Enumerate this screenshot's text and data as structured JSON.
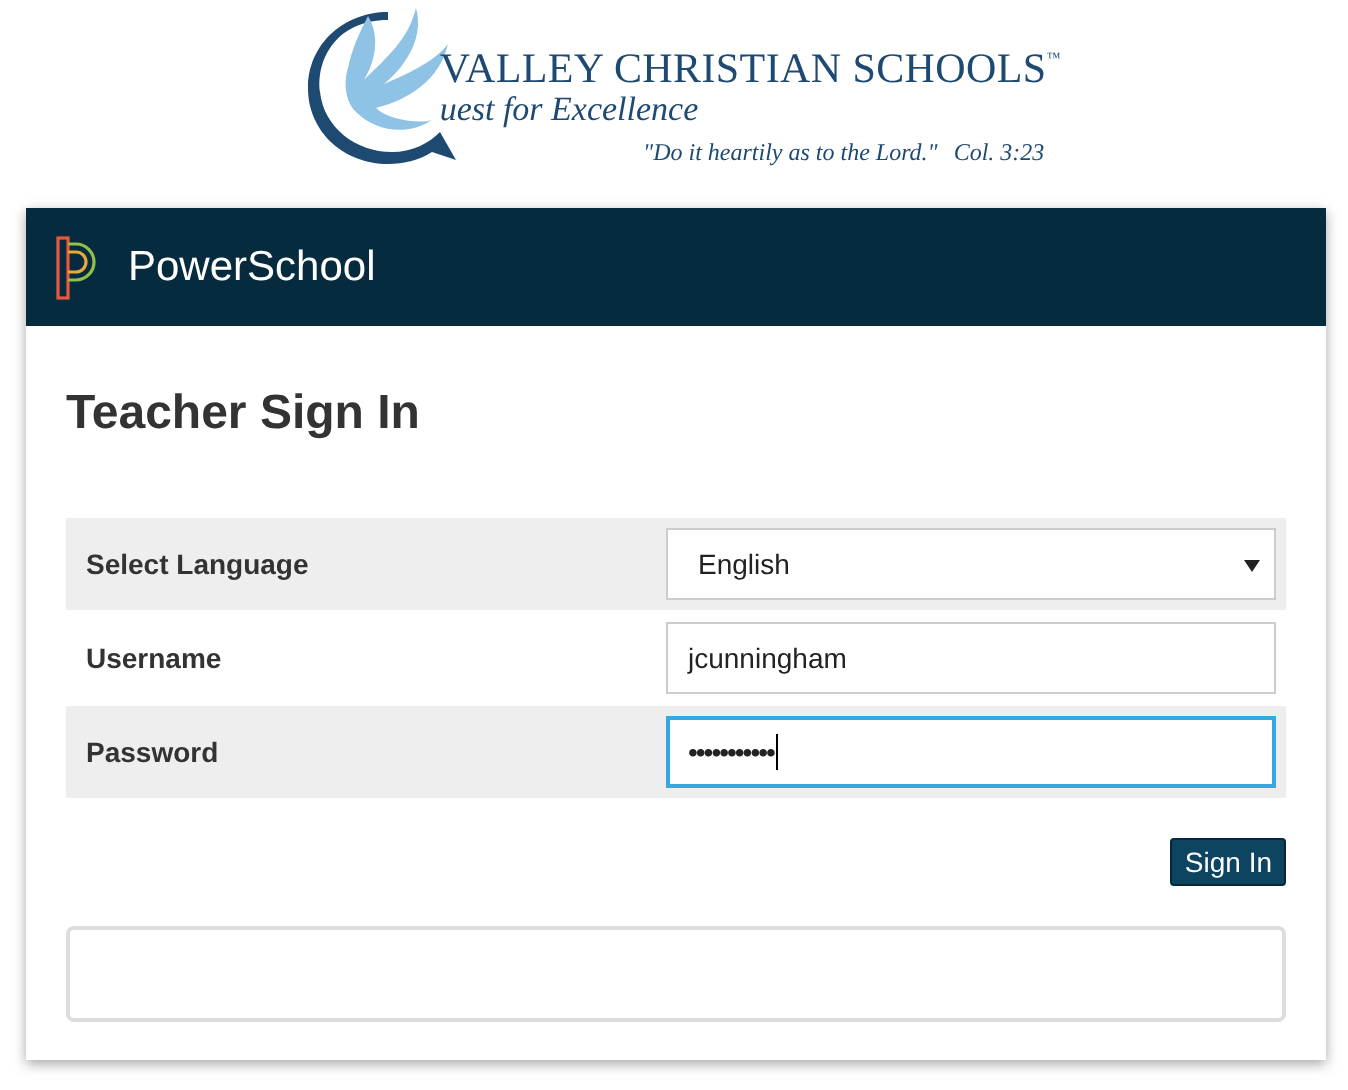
{
  "logo": {
    "name": "VALLEY CHRISTIAN SCHOOLS",
    "trademark": "™",
    "tagline": "uest for Excellence",
    "verse": "\"Do it heartily as to the Lord.\"",
    "reference": "Col. 3:23"
  },
  "header": {
    "brand": "PowerSchool"
  },
  "title": "Teacher Sign In",
  "fields": [
    {
      "kind": "select",
      "label": "Select Language",
      "value": "English",
      "focused": false
    },
    {
      "kind": "text",
      "label": "Username",
      "value": "jcunningham",
      "focused": false
    },
    {
      "kind": "password",
      "label": "Password",
      "value": "•••••••••••",
      "focused": true
    }
  ],
  "button": "Sign In"
}
